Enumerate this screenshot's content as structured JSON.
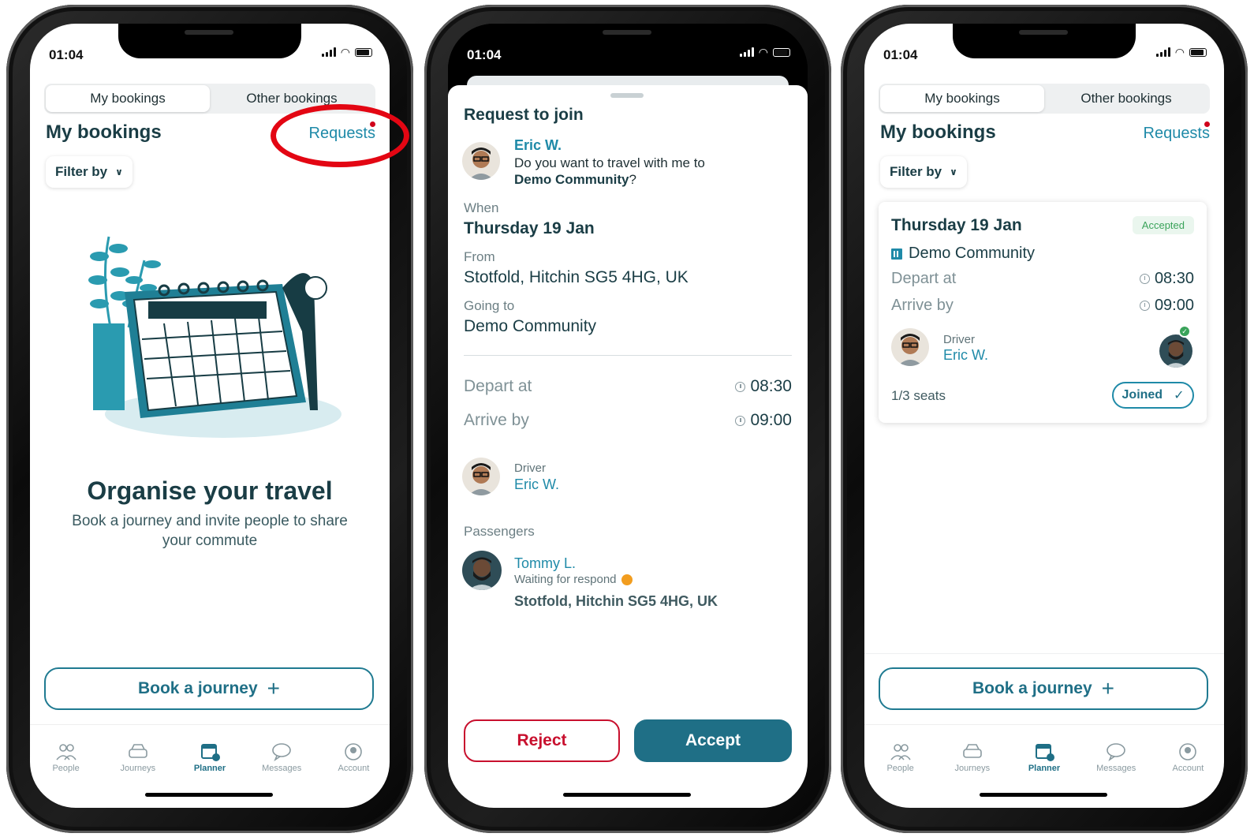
{
  "status": {
    "time": "01:04"
  },
  "tabs": {
    "my": "My bookings",
    "other": "Other bookings"
  },
  "bookings": {
    "title": "My bookings",
    "requests_link": "Requests",
    "filter_label": "Filter by"
  },
  "empty": {
    "title": "Organise your travel",
    "subtitle": "Book a journey and invite people to share your commute"
  },
  "book_button": "Book a journey",
  "nav": [
    "People",
    "Journeys",
    "Planner",
    "Messages",
    "Account"
  ],
  "request": {
    "title": "Request to join",
    "requester": "Eric W.",
    "message_prefix": "Do you want to travel with me to",
    "message_place": "Demo Community",
    "message_suffix": "?",
    "when_label": "When",
    "when_value": "Thursday 19 Jan",
    "from_label": "From",
    "from_value": "Stotfold, Hitchin SG5 4HG, UK",
    "to_label": "Going to",
    "to_value": "Demo Community",
    "depart_label": "Depart at",
    "depart_time": "08:30",
    "arrive_label": "Arrive by",
    "arrive_time": "09:00",
    "driver_label": "Driver",
    "driver_name": "Eric W.",
    "passengers_label": "Passengers",
    "passenger_name": "Tommy L.",
    "passenger_status": "Waiting for respond",
    "passenger_address": "Stotfold, Hitchin SG5 4HG, UK",
    "reject": "Reject",
    "accept": "Accept"
  },
  "card": {
    "date": "Thursday 19 Jan",
    "status": "Accepted",
    "community": "Demo Community",
    "depart_label": "Depart at",
    "depart_time": "08:30",
    "arrive_label": "Arrive by",
    "arrive_time": "09:00",
    "driver_label": "Driver",
    "driver_name": "Eric W.",
    "seats": "1/3 seats",
    "joined": "Joined"
  },
  "colors": {
    "primary": "#1f6f86",
    "link": "#1f8aa8",
    "danger": "#c8102e",
    "success": "#3aa35a",
    "highlight": "#e30613"
  }
}
